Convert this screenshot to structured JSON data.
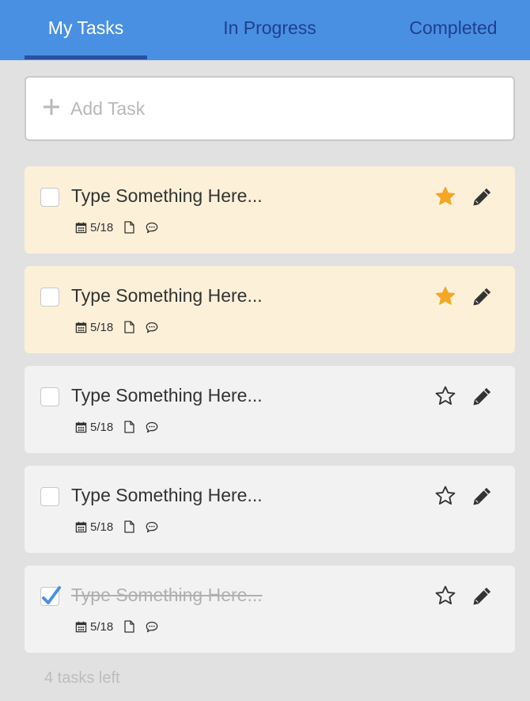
{
  "tabs": [
    {
      "label": "My Tasks",
      "active": true
    },
    {
      "label": "In Progress",
      "active": false
    },
    {
      "label": "Completed",
      "active": false
    }
  ],
  "add_task": {
    "placeholder": "Add Task",
    "value": ""
  },
  "tasks": [
    {
      "title": "Type Something Here...",
      "date": "5/18",
      "starred": true,
      "completed": false
    },
    {
      "title": "Type Something Here...",
      "date": "5/18",
      "starred": true,
      "completed": false
    },
    {
      "title": "Type Something Here...",
      "date": "5/18",
      "starred": false,
      "completed": false
    },
    {
      "title": "Type Something Here...",
      "date": "5/18",
      "starred": false,
      "completed": false
    },
    {
      "title": "Type Something Here...",
      "date": "5/18",
      "starred": false,
      "completed": true
    }
  ],
  "footer": {
    "tasks_left": "4 tasks left"
  },
  "colors": {
    "tab_bar": "#4a90e2",
    "tab_active_text": "#ffffff",
    "tab_inactive_text": "#1f3f8f",
    "tab_underline": "#2b4fa3",
    "starred_card": "#fdf0d9",
    "normal_card": "#f2f2f2",
    "star_filled": "#f5a623",
    "check_blue": "#4a90e2",
    "background": "#e1e1e1"
  },
  "icons": [
    "plus-icon",
    "checkbox",
    "star-icon",
    "pencil-icon",
    "calendar-icon",
    "file-icon",
    "comment-icon"
  ]
}
